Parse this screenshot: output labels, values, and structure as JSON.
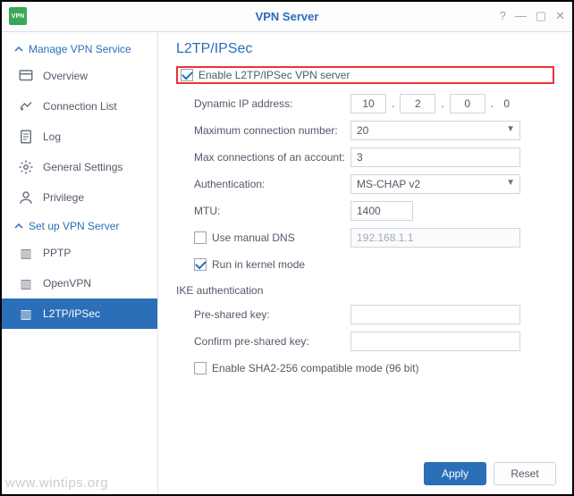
{
  "window": {
    "title": "VPN Server",
    "app_badge": "VPN"
  },
  "sidebar": {
    "section_manage": "Manage VPN Service",
    "section_setup": "Set up VPN Server",
    "items": [
      {
        "label": "Overview"
      },
      {
        "label": "Connection List"
      },
      {
        "label": "Log"
      },
      {
        "label": "General Settings"
      },
      {
        "label": "Privilege"
      }
    ],
    "servers": [
      {
        "label": "PPTP"
      },
      {
        "label": "OpenVPN"
      },
      {
        "label": "L2TP/IPSec"
      }
    ]
  },
  "page": {
    "title": "L2TP/IPSec",
    "enable_label": "Enable L2TP/IPSec VPN server",
    "labels": {
      "dyn_ip": "Dynamic IP address:",
      "max_conn": "Maximum connection number:",
      "max_acc": "Max connections of an account:",
      "auth": "Authentication:",
      "mtu": "MTU:",
      "manual_dns": "Use manual DNS",
      "kernel": "Run in kernel mode",
      "ike": "IKE authentication",
      "psk": "Pre-shared key:",
      "psk2": "Confirm pre-shared key:",
      "sha2": "Enable SHA2-256 compatible mode (96 bit)"
    },
    "values": {
      "ip1": "10",
      "ip2": "2",
      "ip3": "0",
      "ip4": "0",
      "max_conn": "20",
      "max_acc": "3",
      "auth": "MS-CHAP v2",
      "mtu": "1400",
      "dns": "192.168.1.1",
      "psk": "",
      "psk2": ""
    }
  },
  "buttons": {
    "apply": "Apply",
    "reset": "Reset"
  },
  "watermark": "www.wintips.org"
}
